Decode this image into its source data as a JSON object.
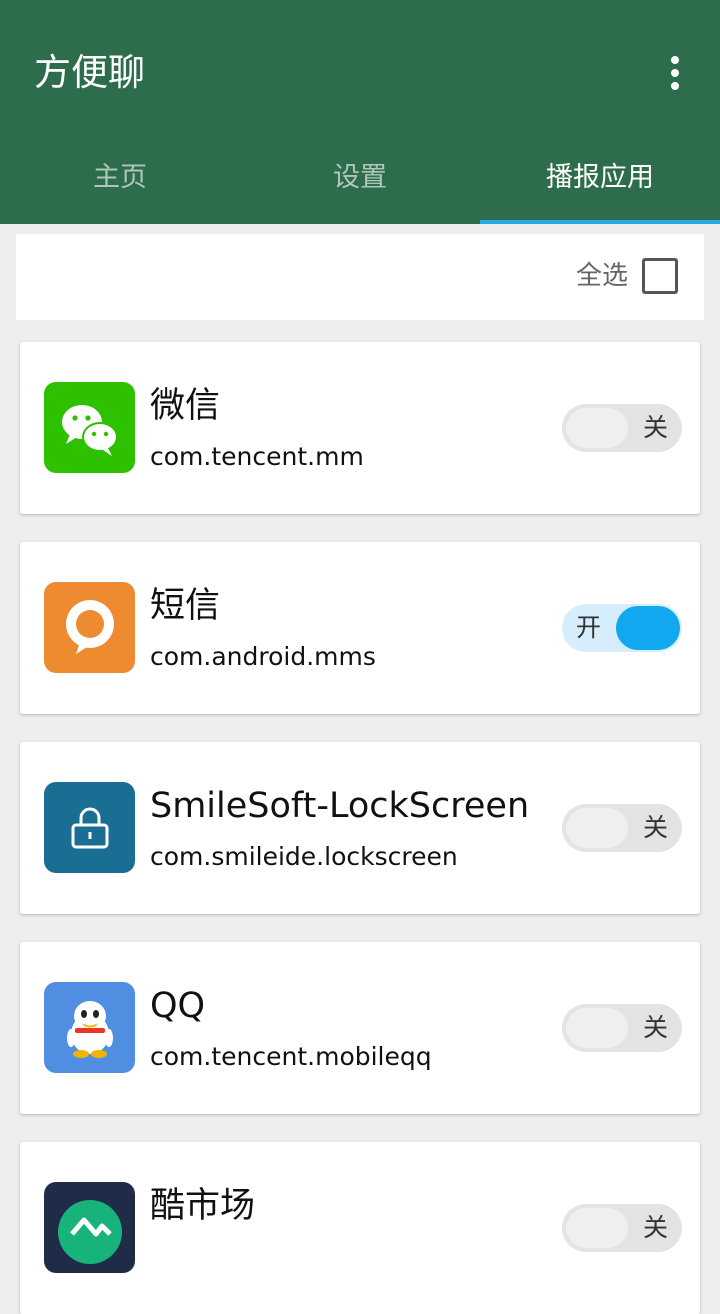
{
  "appbar": {
    "title": "方便聊"
  },
  "tabs": [
    {
      "label": "主页",
      "active": false
    },
    {
      "label": "设置",
      "active": false
    },
    {
      "label": "播报应用",
      "active": true
    }
  ],
  "select_all": {
    "label": "全选",
    "checked": false
  },
  "apps": [
    {
      "name": "微信",
      "package": "com.tencent.mm",
      "icon": "wechat-icon",
      "icon_color": "#2dc100",
      "switch_on": false,
      "switch_text": "关"
    },
    {
      "name": "短信",
      "package": "com.android.mms",
      "icon": "sms-icon",
      "icon_color": "#ee8a30",
      "switch_on": true,
      "switch_text": "开"
    },
    {
      "name": "SmileSoft-LockScreen",
      "package": "com.smileide.lockscreen",
      "icon": "lock-icon",
      "icon_color": "#1a6e93",
      "switch_on": false,
      "switch_text": "关"
    },
    {
      "name": "QQ",
      "package": "com.tencent.mobileqq",
      "icon": "qq-penguin-icon",
      "icon_color": "#4f8ee0",
      "switch_on": false,
      "switch_text": "关"
    },
    {
      "name": "酷市场",
      "package": "",
      "icon": "coolmarket-icon",
      "icon_color": "#1f2b47",
      "switch_on": false,
      "switch_text": "关"
    }
  ],
  "colors": {
    "appbar": "#2d6d4b",
    "tab_indicator": "#29a8e0",
    "switch_on": "#12a8f0"
  }
}
